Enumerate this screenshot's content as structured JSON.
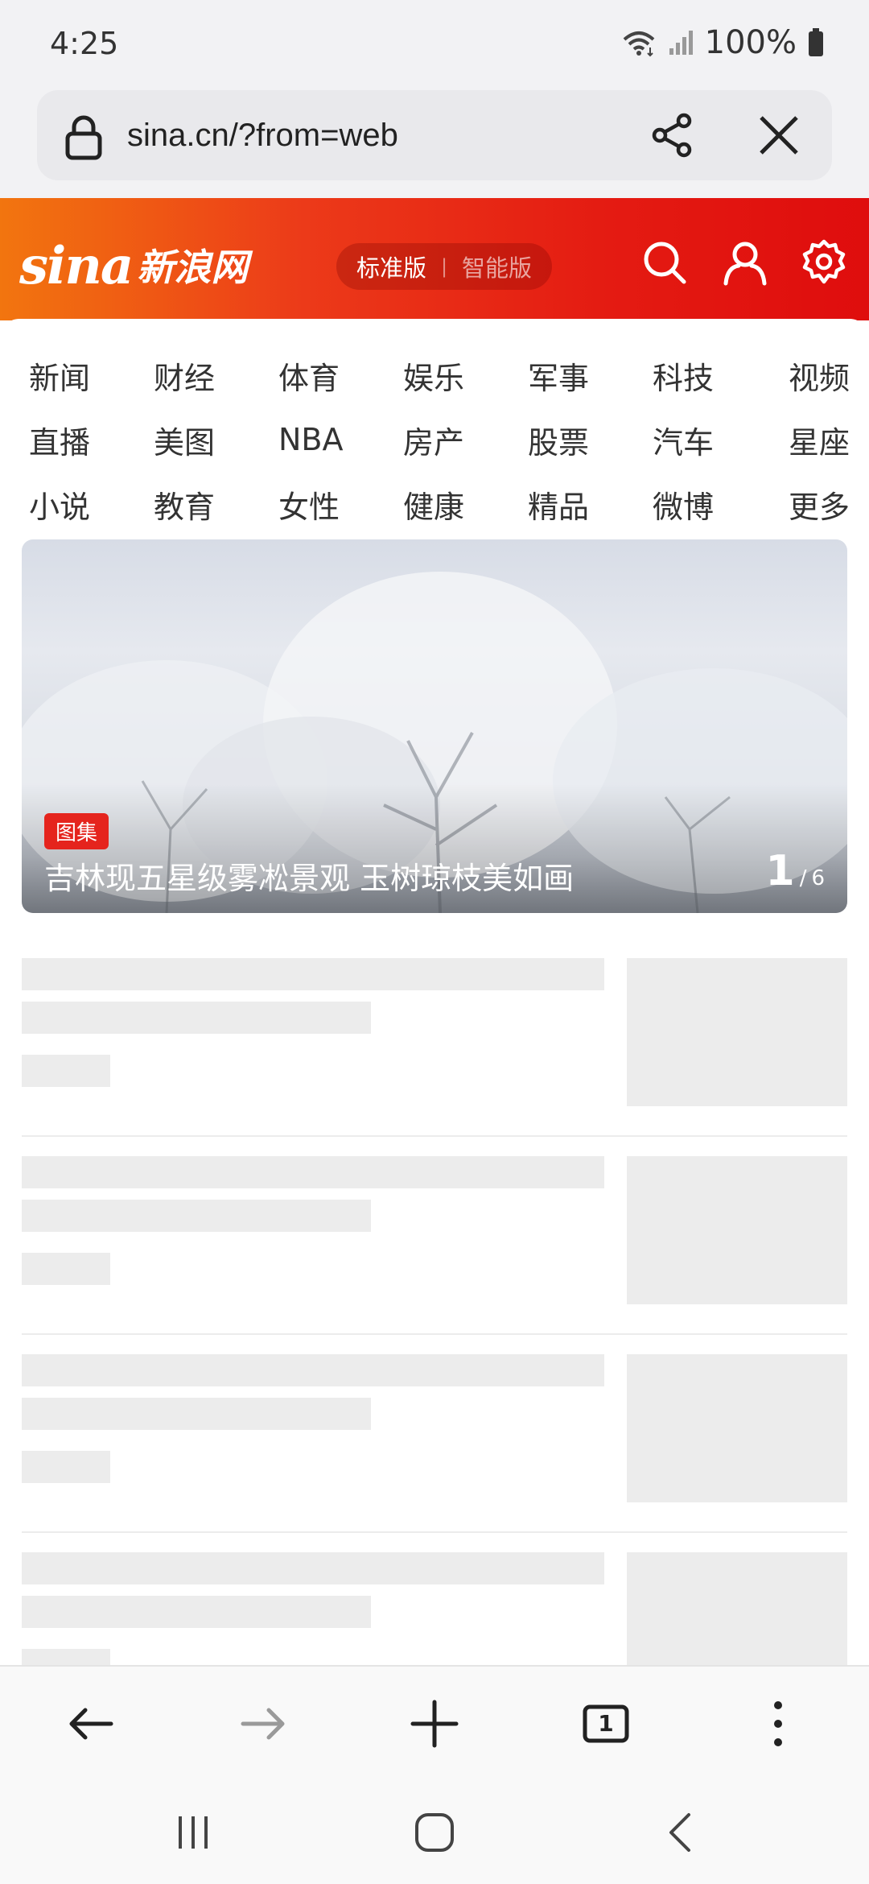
{
  "status_bar": {
    "time": "4:25",
    "battery": "100%"
  },
  "url_bar": {
    "url": "sina.cn/?from=web"
  },
  "header": {
    "logo_text": "sina",
    "logo_cn": "新浪网",
    "version_standard": "标准版",
    "version_separator": "|",
    "version_smart": "智能版",
    "brand_color": "#e41b12"
  },
  "nav": {
    "rows": [
      [
        "新闻",
        "财经",
        "体育",
        "娱乐",
        "军事",
        "科技",
        "视频"
      ],
      [
        "直播",
        "美图",
        "NBA",
        "房产",
        "股票",
        "汽车",
        "星座"
      ],
      [
        "小说",
        "教育",
        "女性",
        "健康",
        "精品",
        "微博",
        "更多"
      ]
    ]
  },
  "featured": {
    "badge": "图集",
    "title": "吉林现五星级雾凇景观 玉树琼枝美如画",
    "current": "1",
    "separator": "/",
    "total": "6"
  },
  "toolbar": {
    "tab_count": "1"
  }
}
